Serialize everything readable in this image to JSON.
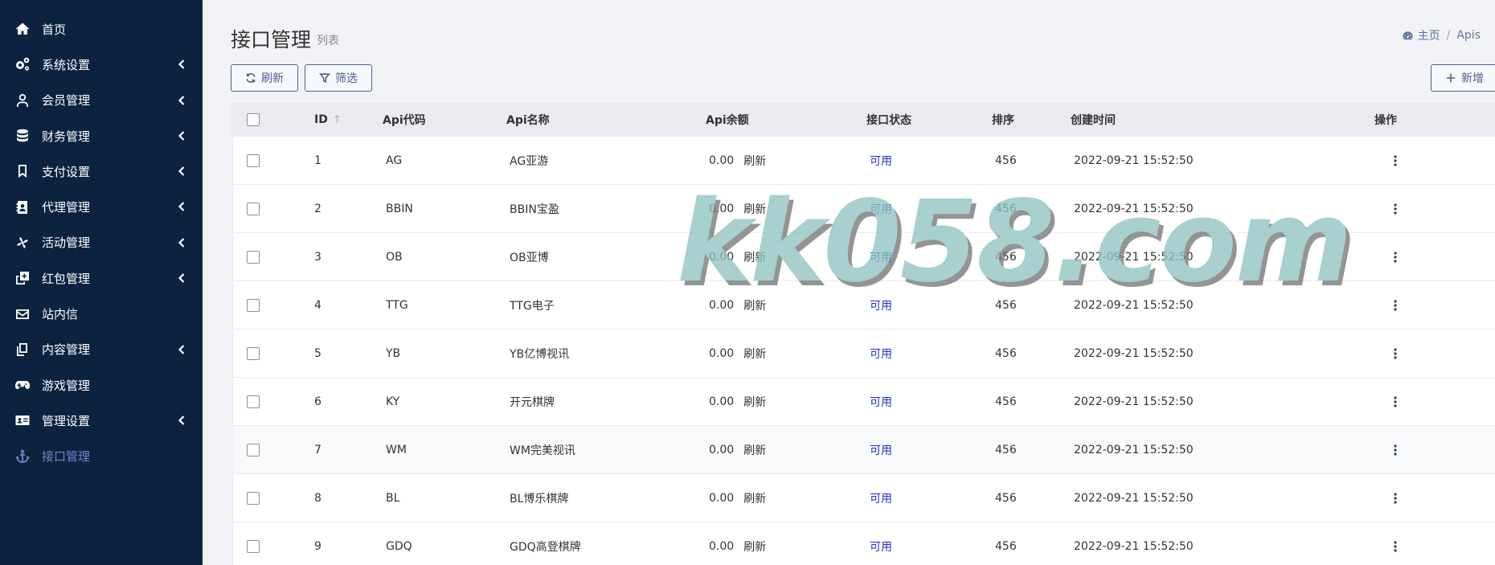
{
  "sidebar": {
    "items": [
      {
        "label": "首页",
        "icon": "home-icon",
        "has_submenu": false
      },
      {
        "label": "系统设置",
        "icon": "gears-icon",
        "has_submenu": true
      },
      {
        "label": "会员管理",
        "icon": "user-icon",
        "has_submenu": true
      },
      {
        "label": "财务管理",
        "icon": "database-icon",
        "has_submenu": true
      },
      {
        "label": "支付设置",
        "icon": "bookmark-icon",
        "has_submenu": true
      },
      {
        "label": "代理管理",
        "icon": "contact-card-icon",
        "has_submenu": true
      },
      {
        "label": "活动管理",
        "icon": "pinwheel-icon",
        "has_submenu": true
      },
      {
        "label": "红包管理",
        "icon": "clone-plus-icon",
        "has_submenu": true
      },
      {
        "label": "站内信",
        "icon": "envelope-icon",
        "has_submenu": false
      },
      {
        "label": "内容管理",
        "icon": "copy-icon",
        "has_submenu": true
      },
      {
        "label": "游戏管理",
        "icon": "gamepad-icon",
        "has_submenu": false
      },
      {
        "label": "管理设置",
        "icon": "id-card-icon",
        "has_submenu": true
      },
      {
        "label": "接口管理",
        "icon": "anchor-icon",
        "has_submenu": false,
        "active": true
      }
    ],
    "colors": {
      "bg": "#0c2340",
      "active": "#6f86c9"
    }
  },
  "header": {
    "title": "接口管理",
    "subtitle": "列表",
    "breadcrumb": {
      "home": "主页",
      "separator": "/",
      "current": "Apis"
    }
  },
  "toolbar": {
    "refresh_label": "刷新",
    "filter_label": "筛选",
    "add_label": "新增"
  },
  "table": {
    "columns": {
      "id": "ID",
      "code": "Api代码",
      "name": "Api名称",
      "balance": "Api余额",
      "status": "接口状态",
      "sort": "排序",
      "created": "创建时间",
      "actions": "操作"
    },
    "refresh_link": "刷新",
    "rows": [
      {
        "id": "1",
        "code": "AG",
        "name": "AG亚游",
        "balance": "0.00",
        "status": "可用",
        "sort": "456",
        "created": "2022-09-21 15:52:50"
      },
      {
        "id": "2",
        "code": "BBIN",
        "name": "BBIN宝盈",
        "balance": "0.00",
        "status": "可用",
        "sort": "456",
        "created": "2022-09-21 15:52:50"
      },
      {
        "id": "3",
        "code": "OB",
        "name": "OB亚博",
        "balance": "0.00",
        "status": "可用",
        "sort": "456",
        "created": "2022-09-21 15:52:50"
      },
      {
        "id": "4",
        "code": "TTG",
        "name": "TTG电子",
        "balance": "0.00",
        "status": "可用",
        "sort": "456",
        "created": "2022-09-21 15:52:50"
      },
      {
        "id": "5",
        "code": "YB",
        "name": "YB亿博视讯",
        "balance": "0.00",
        "status": "可用",
        "sort": "456",
        "created": "2022-09-21 15:52:50"
      },
      {
        "id": "6",
        "code": "KY",
        "name": "开元棋牌",
        "balance": "0.00",
        "status": "可用",
        "sort": "456",
        "created": "2022-09-21 15:52:50"
      },
      {
        "id": "7",
        "code": "WM",
        "name": "WM完美视讯",
        "balance": "0.00",
        "status": "可用",
        "sort": "456",
        "created": "2022-09-21 15:52:50"
      },
      {
        "id": "8",
        "code": "BL",
        "name": "BL博乐棋牌",
        "balance": "0.00",
        "status": "可用",
        "sort": "456",
        "created": "2022-09-21 15:52:50"
      },
      {
        "id": "9",
        "code": "GDQ",
        "name": "GDQ高登棋牌",
        "balance": "0.00",
        "status": "可用",
        "sort": "456",
        "created": "2022-09-21 15:52:50"
      }
    ],
    "status_color": "#2330c9"
  },
  "watermark": {
    "text": "kk058.com"
  }
}
